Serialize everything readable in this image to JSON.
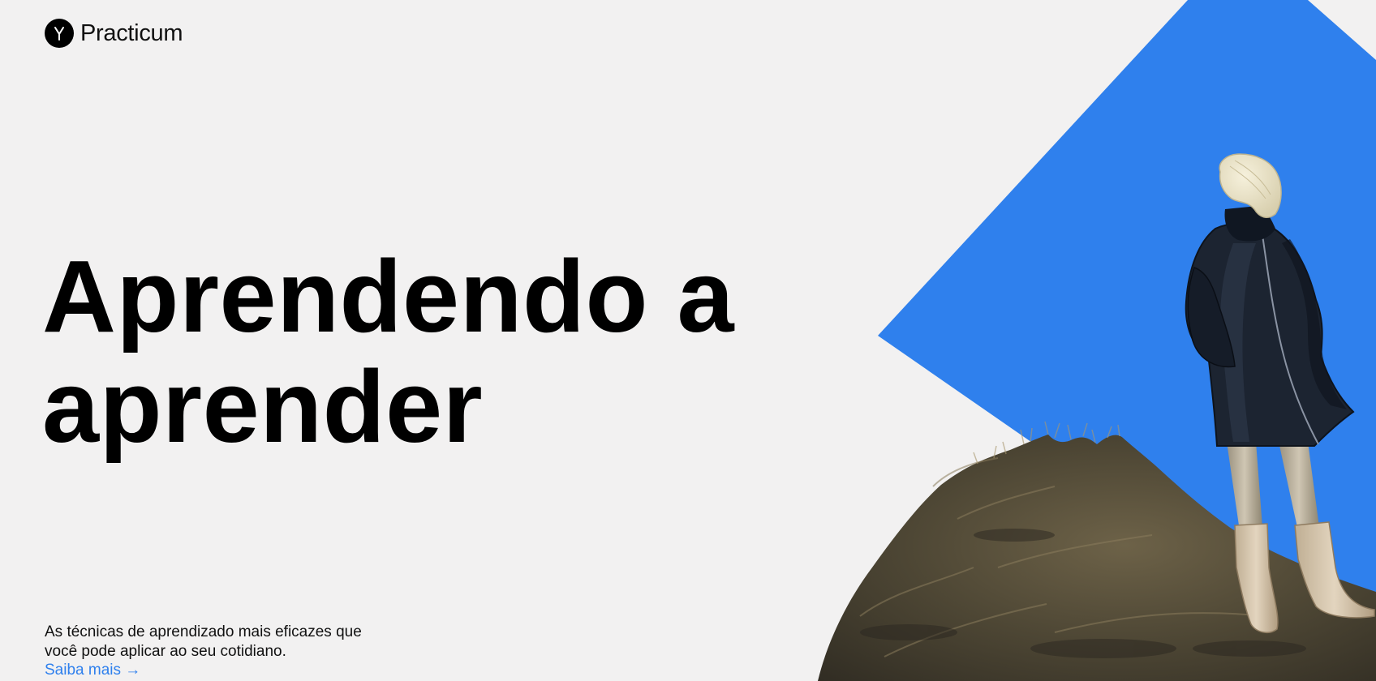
{
  "brand": {
    "name": "Practicum",
    "mark_letter": "Y"
  },
  "hero": {
    "title_line_1": "Aprendendo a",
    "title_line_2": "aprender",
    "description_line_1": "As técnicas de aprendizado mais eficazes que",
    "description_line_2": "você pode aplicar ao seu cotidiano.",
    "cta_label": "Saiba mais →"
  },
  "colors": {
    "background": "#f2f1f1",
    "accent_blue": "#2f80ed",
    "text": "#000000"
  },
  "icons": {
    "logo": "practicum-logo-icon",
    "illustration": "person-on-hill-illustration"
  }
}
